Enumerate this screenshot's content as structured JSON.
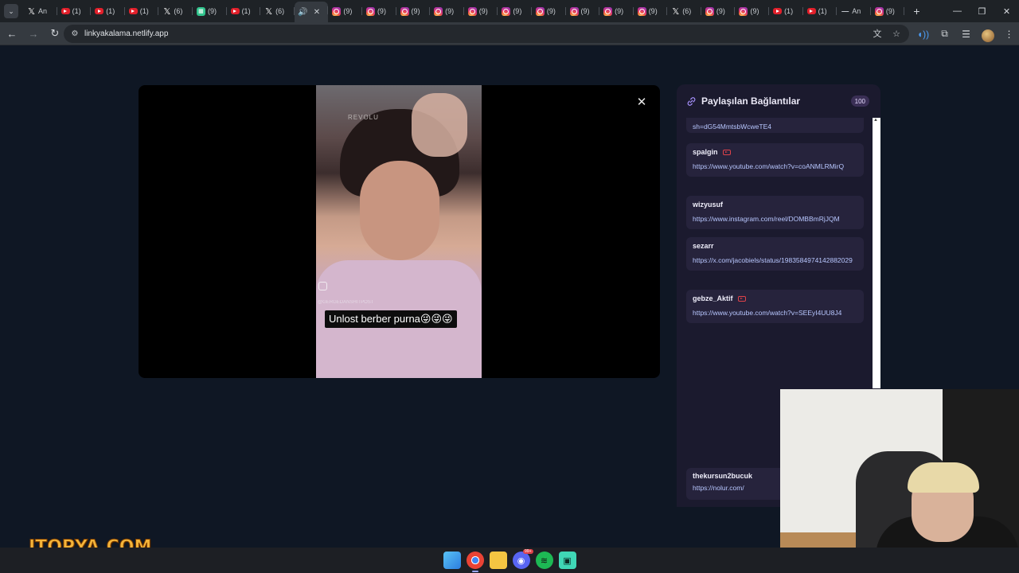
{
  "browser": {
    "tabs": [
      {
        "icon": "x",
        "label": "An"
      },
      {
        "icon": "youtube",
        "label": "(1)"
      },
      {
        "icon": "youtube",
        "label": "(1)"
      },
      {
        "icon": "youtube",
        "label": "(1)"
      },
      {
        "icon": "x",
        "label": "(6)"
      },
      {
        "icon": "grid",
        "label": "(9)"
      },
      {
        "icon": "youtube",
        "label": "(1)"
      },
      {
        "icon": "x",
        "label": "(6)"
      },
      {
        "icon": "speaker",
        "label": "",
        "active": true
      },
      {
        "icon": "instagram",
        "label": "(9)"
      },
      {
        "icon": "instagram",
        "label": "(9)"
      },
      {
        "icon": "instagram",
        "label": "(9)"
      },
      {
        "icon": "instagram",
        "label": "(9)"
      },
      {
        "icon": "instagram",
        "label": "(9)"
      },
      {
        "icon": "instagram",
        "label": "(9)"
      },
      {
        "icon": "instagram",
        "label": "(9)"
      },
      {
        "icon": "instagram",
        "label": "(9)"
      },
      {
        "icon": "instagram",
        "label": "(9)"
      },
      {
        "icon": "instagram",
        "label": "(9)"
      },
      {
        "icon": "x",
        "label": "(6)"
      },
      {
        "icon": "instagram",
        "label": "(9)"
      },
      {
        "icon": "instagram",
        "label": "(9)"
      },
      {
        "icon": "youtube",
        "label": "(1)"
      },
      {
        "icon": "youtube",
        "label": "(1)"
      },
      {
        "icon": "dash",
        "label": "An"
      },
      {
        "icon": "instagram",
        "label": "(9)"
      }
    ],
    "url": "linkyakalama.netlify.app"
  },
  "video": {
    "caption": "Unlost berber purna😜😜😜",
    "watermark": "@GERGEDANSHITPOST",
    "brand_text": "REVOLU"
  },
  "panel": {
    "title": "Paylaşılan Bağlantılar",
    "count": "100",
    "partial_url": "sh=dG54MmtsbWcweTE4",
    "links": [
      {
        "user": "spalgin",
        "url": "https://www.youtube.com/watch?v=coANMLRMirQ",
        "youtube": true
      },
      {
        "user": "wizyusuf",
        "url": "https://www.instagram.com/reel/DOMBBmRjJQM",
        "youtube": false
      },
      {
        "user": "sezarr",
        "url": "https://x.com/jacobiels/status/1983584974142882029",
        "youtube": false
      },
      {
        "user": "gebze_Aktif",
        "url": "https://www.youtube.com/watch?v=SEEyI4UU8J4",
        "youtube": true
      }
    ],
    "bottom_link": {
      "user": "thekursun2bucuk",
      "url": "https://nolur.com/"
    }
  },
  "overlay": {
    "brand": "ITOPYA.COM"
  },
  "taskbar": {
    "discord_badge": "99+"
  },
  "colors": {
    "page_bg": "#0f1724",
    "panel_bg": "#1b1a2e",
    "card_bg": "#26233c",
    "link_color": "#b8c7ff",
    "badge_bg": "#3a2f55"
  }
}
